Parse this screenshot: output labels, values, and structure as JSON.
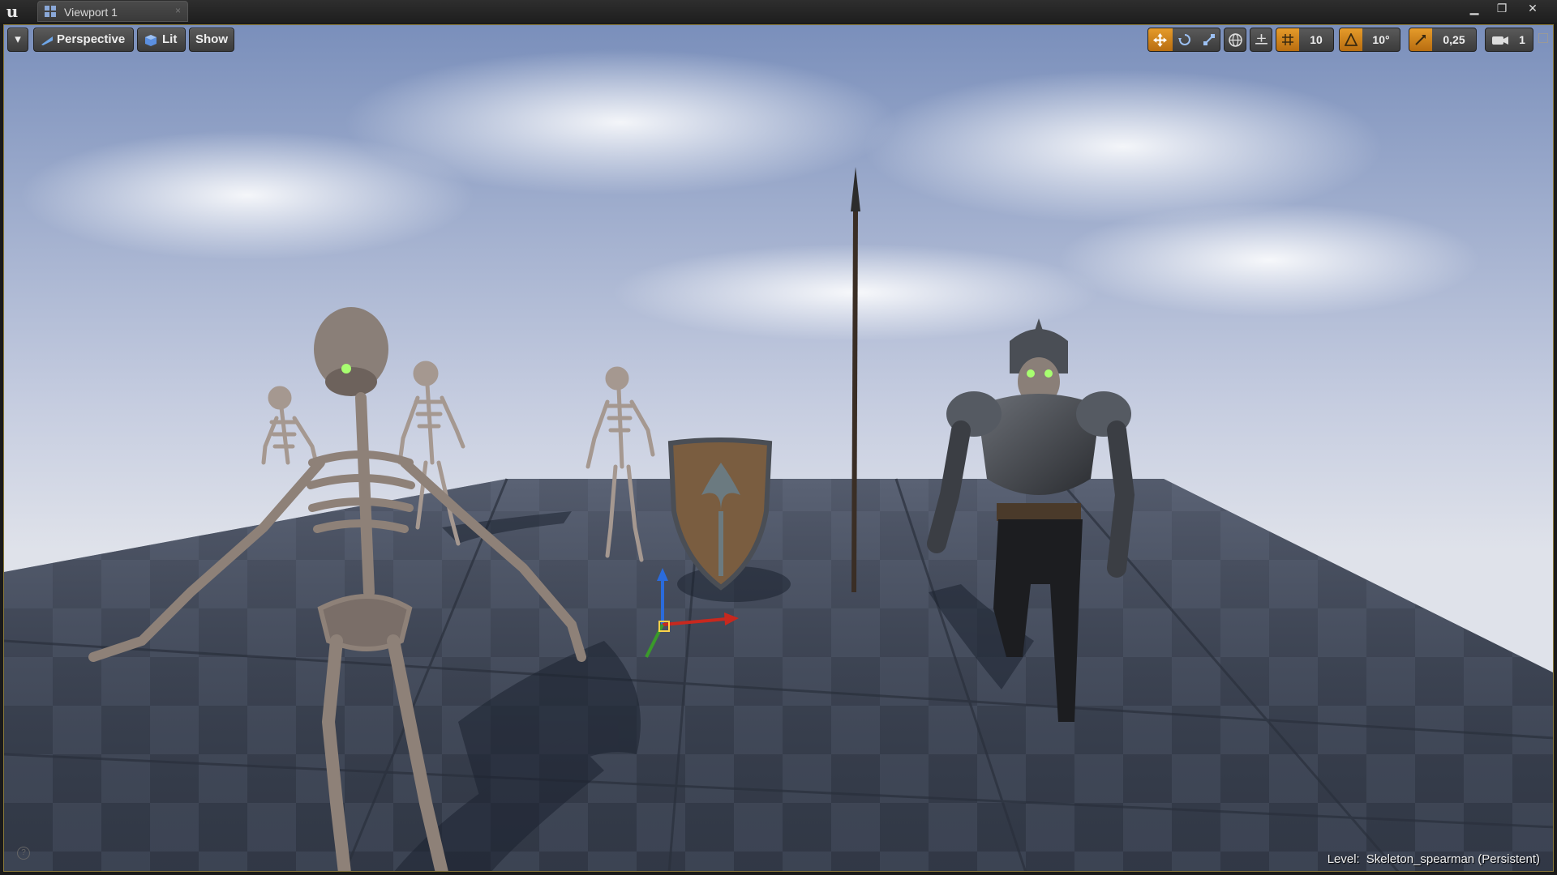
{
  "window": {
    "tab_label": "Viewport 1",
    "minimize_glyph": "▁",
    "maximize_glyph": "❐",
    "close_glyph": "✕"
  },
  "toolbar": {
    "menu_glyph": "▾",
    "perspective_label": "Perspective",
    "lit_label": "Lit",
    "show_label": "Show",
    "grid_snap_value": "10",
    "rotation_snap_value": "10°",
    "scale_snap_value": "0,25",
    "camera_speed_value": "1"
  },
  "status": {
    "level_label": "Level:",
    "level_name": "Skeleton_spearman (Persistent)"
  },
  "icons": [
    "ue-logo-icon",
    "viewport-tab-icon",
    "dropdown-icon",
    "perspective-icon",
    "lit-icon",
    "translate-icon",
    "rotate-icon",
    "scale-icon",
    "world-local-icon",
    "surface-snap-icon",
    "grid-snap-icon",
    "rotation-snap-icon",
    "scale-snap-icon",
    "camera-speed-icon",
    "maximize-viewport-icon",
    "help-icon"
  ],
  "colors": {
    "accent_orange": "#d98a1e",
    "viewport_border": "#8a7a3a",
    "sky_top": "#7e93bd",
    "floor_dark": "#3a4252"
  }
}
